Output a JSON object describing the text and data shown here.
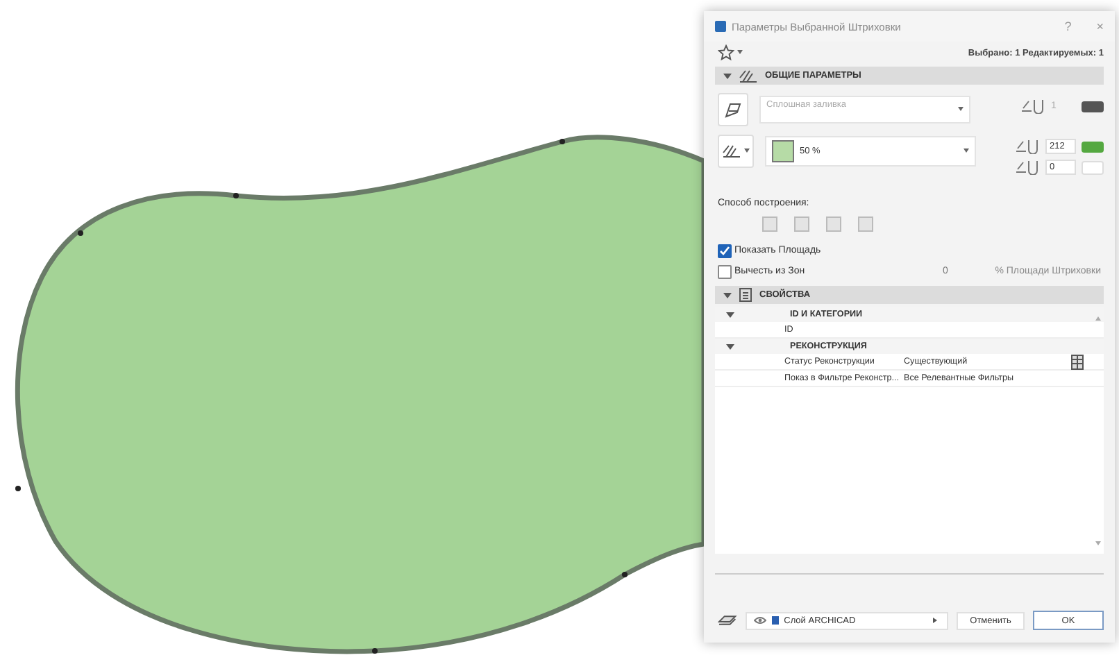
{
  "window": {
    "title": "Параметры Выбранной Штриховки",
    "help": "?",
    "close": "×"
  },
  "selection_info": "Выбрано: 1 Редактируемых: 1",
  "general": {
    "title": "ОБЩИЕ ПАРАМЕТРЫ",
    "expanded": true,
    "fill_type": "Сплошная заливка",
    "fill_pen": "1",
    "opacity": "50 %",
    "background_pen": "212",
    "foreground_pen": "0"
  },
  "construction": {
    "label": "Способ построения:"
  },
  "checkboxes": [
    {
      "label": "Показать Площадь",
      "checked": true
    },
    {
      "label": "Вычесть из Зон",
      "checked": false
    }
  ],
  "subtract": {
    "value": "0",
    "unit": "% Площади Штриховки"
  },
  "properties": {
    "title": "СВОЙСТВА",
    "expanded": true,
    "groups": [
      {
        "label": "ID И КАТЕГОРИИ",
        "expanded": true,
        "children": [
          {
            "name": "ID"
          }
        ]
      },
      {
        "label": "РЕКОНСТРУКЦИЯ",
        "expanded": true,
        "children": [
          {
            "name": "Статус Реконструкции",
            "value": "Существующий"
          },
          {
            "name": "Показ в Фильтре Реконстр...",
            "value": "Все Релевантные Фильтры"
          }
        ]
      }
    ]
  },
  "footer": {
    "layer": "Слой ARCHICAD",
    "cancel": "Отменить",
    "ok": "OK"
  }
}
